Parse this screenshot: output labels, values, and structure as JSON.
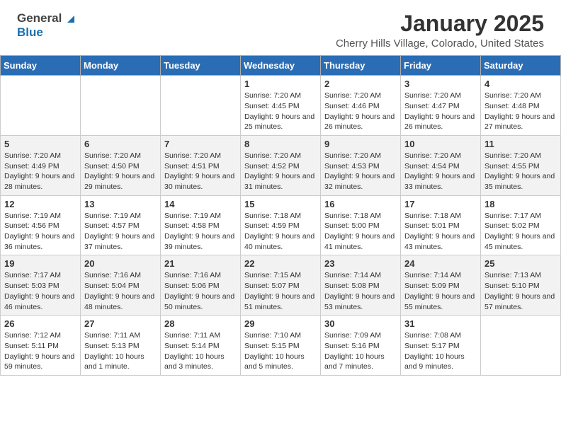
{
  "header": {
    "logo": {
      "general": "General",
      "blue": "Blue"
    },
    "title": "January 2025",
    "location": "Cherry Hills Village, Colorado, United States"
  },
  "weekdays": [
    "Sunday",
    "Monday",
    "Tuesday",
    "Wednesday",
    "Thursday",
    "Friday",
    "Saturday"
  ],
  "weeks": [
    [
      {
        "day": "",
        "sunrise": "",
        "sunset": "",
        "daylight": ""
      },
      {
        "day": "",
        "sunrise": "",
        "sunset": "",
        "daylight": ""
      },
      {
        "day": "",
        "sunrise": "",
        "sunset": "",
        "daylight": ""
      },
      {
        "day": "1",
        "sunrise": "Sunrise: 7:20 AM",
        "sunset": "Sunset: 4:45 PM",
        "daylight": "Daylight: 9 hours and 25 minutes."
      },
      {
        "day": "2",
        "sunrise": "Sunrise: 7:20 AM",
        "sunset": "Sunset: 4:46 PM",
        "daylight": "Daylight: 9 hours and 26 minutes."
      },
      {
        "day": "3",
        "sunrise": "Sunrise: 7:20 AM",
        "sunset": "Sunset: 4:47 PM",
        "daylight": "Daylight: 9 hours and 26 minutes."
      },
      {
        "day": "4",
        "sunrise": "Sunrise: 7:20 AM",
        "sunset": "Sunset: 4:48 PM",
        "daylight": "Daylight: 9 hours and 27 minutes."
      }
    ],
    [
      {
        "day": "5",
        "sunrise": "Sunrise: 7:20 AM",
        "sunset": "Sunset: 4:49 PM",
        "daylight": "Daylight: 9 hours and 28 minutes."
      },
      {
        "day": "6",
        "sunrise": "Sunrise: 7:20 AM",
        "sunset": "Sunset: 4:50 PM",
        "daylight": "Daylight: 9 hours and 29 minutes."
      },
      {
        "day": "7",
        "sunrise": "Sunrise: 7:20 AM",
        "sunset": "Sunset: 4:51 PM",
        "daylight": "Daylight: 9 hours and 30 minutes."
      },
      {
        "day": "8",
        "sunrise": "Sunrise: 7:20 AM",
        "sunset": "Sunset: 4:52 PM",
        "daylight": "Daylight: 9 hours and 31 minutes."
      },
      {
        "day": "9",
        "sunrise": "Sunrise: 7:20 AM",
        "sunset": "Sunset: 4:53 PM",
        "daylight": "Daylight: 9 hours and 32 minutes."
      },
      {
        "day": "10",
        "sunrise": "Sunrise: 7:20 AM",
        "sunset": "Sunset: 4:54 PM",
        "daylight": "Daylight: 9 hours and 33 minutes."
      },
      {
        "day": "11",
        "sunrise": "Sunrise: 7:20 AM",
        "sunset": "Sunset: 4:55 PM",
        "daylight": "Daylight: 9 hours and 35 minutes."
      }
    ],
    [
      {
        "day": "12",
        "sunrise": "Sunrise: 7:19 AM",
        "sunset": "Sunset: 4:56 PM",
        "daylight": "Daylight: 9 hours and 36 minutes."
      },
      {
        "day": "13",
        "sunrise": "Sunrise: 7:19 AM",
        "sunset": "Sunset: 4:57 PM",
        "daylight": "Daylight: 9 hours and 37 minutes."
      },
      {
        "day": "14",
        "sunrise": "Sunrise: 7:19 AM",
        "sunset": "Sunset: 4:58 PM",
        "daylight": "Daylight: 9 hours and 39 minutes."
      },
      {
        "day": "15",
        "sunrise": "Sunrise: 7:18 AM",
        "sunset": "Sunset: 4:59 PM",
        "daylight": "Daylight: 9 hours and 40 minutes."
      },
      {
        "day": "16",
        "sunrise": "Sunrise: 7:18 AM",
        "sunset": "Sunset: 5:00 PM",
        "daylight": "Daylight: 9 hours and 41 minutes."
      },
      {
        "day": "17",
        "sunrise": "Sunrise: 7:18 AM",
        "sunset": "Sunset: 5:01 PM",
        "daylight": "Daylight: 9 hours and 43 minutes."
      },
      {
        "day": "18",
        "sunrise": "Sunrise: 7:17 AM",
        "sunset": "Sunset: 5:02 PM",
        "daylight": "Daylight: 9 hours and 45 minutes."
      }
    ],
    [
      {
        "day": "19",
        "sunrise": "Sunrise: 7:17 AM",
        "sunset": "Sunset: 5:03 PM",
        "daylight": "Daylight: 9 hours and 46 minutes."
      },
      {
        "day": "20",
        "sunrise": "Sunrise: 7:16 AM",
        "sunset": "Sunset: 5:04 PM",
        "daylight": "Daylight: 9 hours and 48 minutes."
      },
      {
        "day": "21",
        "sunrise": "Sunrise: 7:16 AM",
        "sunset": "Sunset: 5:06 PM",
        "daylight": "Daylight: 9 hours and 50 minutes."
      },
      {
        "day": "22",
        "sunrise": "Sunrise: 7:15 AM",
        "sunset": "Sunset: 5:07 PM",
        "daylight": "Daylight: 9 hours and 51 minutes."
      },
      {
        "day": "23",
        "sunrise": "Sunrise: 7:14 AM",
        "sunset": "Sunset: 5:08 PM",
        "daylight": "Daylight: 9 hours and 53 minutes."
      },
      {
        "day": "24",
        "sunrise": "Sunrise: 7:14 AM",
        "sunset": "Sunset: 5:09 PM",
        "daylight": "Daylight: 9 hours and 55 minutes."
      },
      {
        "day": "25",
        "sunrise": "Sunrise: 7:13 AM",
        "sunset": "Sunset: 5:10 PM",
        "daylight": "Daylight: 9 hours and 57 minutes."
      }
    ],
    [
      {
        "day": "26",
        "sunrise": "Sunrise: 7:12 AM",
        "sunset": "Sunset: 5:11 PM",
        "daylight": "Daylight: 9 hours and 59 minutes."
      },
      {
        "day": "27",
        "sunrise": "Sunrise: 7:11 AM",
        "sunset": "Sunset: 5:13 PM",
        "daylight": "Daylight: 10 hours and 1 minute."
      },
      {
        "day": "28",
        "sunrise": "Sunrise: 7:11 AM",
        "sunset": "Sunset: 5:14 PM",
        "daylight": "Daylight: 10 hours and 3 minutes."
      },
      {
        "day": "29",
        "sunrise": "Sunrise: 7:10 AM",
        "sunset": "Sunset: 5:15 PM",
        "daylight": "Daylight: 10 hours and 5 minutes."
      },
      {
        "day": "30",
        "sunrise": "Sunrise: 7:09 AM",
        "sunset": "Sunset: 5:16 PM",
        "daylight": "Daylight: 10 hours and 7 minutes."
      },
      {
        "day": "31",
        "sunrise": "Sunrise: 7:08 AM",
        "sunset": "Sunset: 5:17 PM",
        "daylight": "Daylight: 10 hours and 9 minutes."
      },
      {
        "day": "",
        "sunrise": "",
        "sunset": "",
        "daylight": ""
      }
    ]
  ]
}
